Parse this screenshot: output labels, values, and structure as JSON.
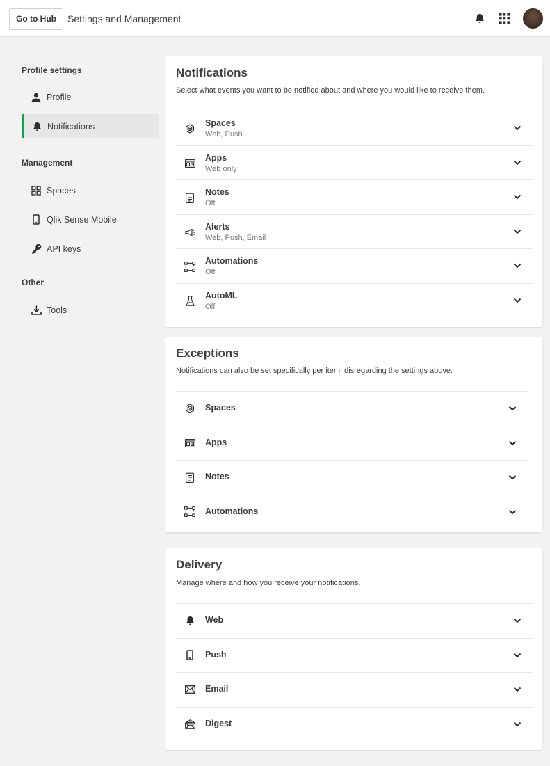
{
  "header": {
    "hub_button": "Go to Hub",
    "title": "Settings and Management",
    "icons": [
      "bell-icon",
      "grid-menu-icon"
    ]
  },
  "sidebar": {
    "sections": [
      {
        "title": "Profile settings",
        "items": [
          {
            "label": "Profile",
            "icon": "person-icon"
          },
          {
            "label": "Notifications",
            "icon": "bell-icon",
            "active": true
          }
        ]
      },
      {
        "title": "Management",
        "items": [
          {
            "label": "Spaces",
            "icon": "spaces-icon"
          },
          {
            "label": "Qlik Sense Mobile",
            "icon": "mobile-icon"
          },
          {
            "label": "API keys",
            "icon": "key-icon"
          }
        ]
      },
      {
        "title": "Other",
        "items": [
          {
            "label": "Tools",
            "icon": "download-icon"
          }
        ]
      }
    ]
  },
  "notifications": {
    "title": "Notifications",
    "description": "Select what events you want to be notified about and where you would like to receive them.",
    "rows": [
      {
        "label": "Spaces",
        "sub": "Web, Push",
        "icon": "spaces-cube-icon"
      },
      {
        "label": "Apps",
        "sub": "Web only",
        "icon": "apps-icon"
      },
      {
        "label": "Notes",
        "sub": "Off",
        "icon": "notes-icon"
      },
      {
        "label": "Alerts",
        "sub": "Web, Push, Email",
        "icon": "megaphone-icon"
      },
      {
        "label": "Automations",
        "sub": "Off",
        "icon": "automations-icon"
      },
      {
        "label": "AutoML",
        "sub": "Off",
        "icon": "flask-icon"
      }
    ]
  },
  "exceptions": {
    "title": "Exceptions",
    "description": "Notifications can also be set specifically per item, disregarding the settings above.",
    "rows": [
      {
        "label": "Spaces",
        "icon": "spaces-cube-icon"
      },
      {
        "label": "Apps",
        "icon": "apps-icon"
      },
      {
        "label": "Notes",
        "icon": "notes-icon"
      },
      {
        "label": "Automations",
        "icon": "automations-icon"
      }
    ]
  },
  "delivery": {
    "title": "Delivery",
    "description": "Manage where and how you receive your notifications.",
    "rows": [
      {
        "label": "Web",
        "icon": "bell-icon"
      },
      {
        "label": "Push",
        "icon": "mobile-icon"
      },
      {
        "label": "Email",
        "icon": "envelope-icon"
      },
      {
        "label": "Digest",
        "icon": "digest-envelope-icon"
      }
    ]
  },
  "colors": {
    "accent": "#10a24f",
    "background": "#f2f2f2",
    "card": "#ffffff"
  }
}
